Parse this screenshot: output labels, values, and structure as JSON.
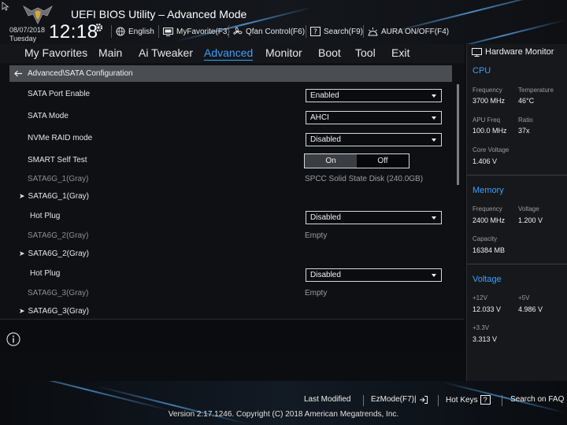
{
  "header": {
    "title": "UEFI BIOS Utility – Advanced Mode",
    "date": "08/07/2018",
    "day": "Tuesday",
    "time": "12:18",
    "toolbar": [
      {
        "label": "English",
        "icon": "globe-icon"
      },
      {
        "label": "MyFavorite(F3)",
        "icon": "favorite-icon"
      },
      {
        "label": "Qfan Control(F6)",
        "icon": "fan-icon"
      },
      {
        "label": "Search(F9)",
        "icon": "search-icon"
      },
      {
        "label": "AURA ON/OFF(F4)",
        "icon": "aura-icon"
      }
    ]
  },
  "menu": {
    "items": [
      "My Favorites",
      "Main",
      "Ai Tweaker",
      "Advanced",
      "Monitor",
      "Boot",
      "Tool",
      "Exit"
    ],
    "active": "Advanced"
  },
  "main": {
    "breadcrumb": "Advanced\\SATA Configuration",
    "rows": {
      "sata_port_enable": {
        "label": "SATA Port Enable",
        "value": "Enabled"
      },
      "sata_mode": {
        "label": "SATA Mode",
        "value": "AHCI"
      },
      "nvme_raid": {
        "label": "NVMe RAID mode",
        "value": "Disabled"
      },
      "smart": {
        "label": "SMART Self Test",
        "on": "On",
        "off": "Off"
      },
      "port1_info": {
        "label": "SATA6G_1(Gray)",
        "value": "SPCC Solid State Disk (240.0GB)"
      },
      "port1": {
        "label": "SATA6G_1(Gray)"
      },
      "hotplug1": {
        "label": "Hot Plug",
        "value": "Disabled"
      },
      "port2_info": {
        "label": "SATA6G_2(Gray)",
        "value": "Empty"
      },
      "port2": {
        "label": "SATA6G_2(Gray)"
      },
      "hotplug2": {
        "label": "Hot Plug",
        "value": "Disabled"
      },
      "port3_info": {
        "label": "SATA6G_3(Gray)",
        "value": "Empty"
      },
      "port3": {
        "label": "SATA6G_3(Gray)"
      }
    }
  },
  "hwmon": {
    "title": "Hardware Monitor",
    "cpu": {
      "title": "CPU",
      "frequency_label": "Frequency",
      "frequency": "3700 MHz",
      "temperature_label": "Temperature",
      "temperature": "46°C",
      "apu_label": "APU Freq",
      "apu": "100.0 MHz",
      "ratio_label": "Ratio",
      "ratio": "37x",
      "voltage_label": "Core Voltage",
      "voltage": "1.406 V"
    },
    "memory": {
      "title": "Memory",
      "frequency_label": "Frequency",
      "frequency": "2400 MHz",
      "voltage_label": "Voltage",
      "voltage": "1.200 V",
      "capacity_label": "Capacity",
      "capacity": "16384 MB"
    },
    "voltage": {
      "title": "Voltage",
      "v12_label": "+12V",
      "v12": "12.033 V",
      "v5_label": "+5V",
      "v5": "4.986 V",
      "v33_label": "+3.3V",
      "v33": "3.313 V"
    }
  },
  "footer": {
    "last_modified": "Last Modified",
    "ezmode": "EzMode(F7)|",
    "hotkeys": "Hot Keys",
    "hotkeys_key": "?",
    "faq": "Search on FAQ",
    "copyright": "Version 2.17.1246. Copyright (C) 2018 American Megatrends, Inc."
  },
  "colors": {
    "accent": "#3aa0ff",
    "background": "#0e1013",
    "breadcrumb": "#4a4d52"
  }
}
